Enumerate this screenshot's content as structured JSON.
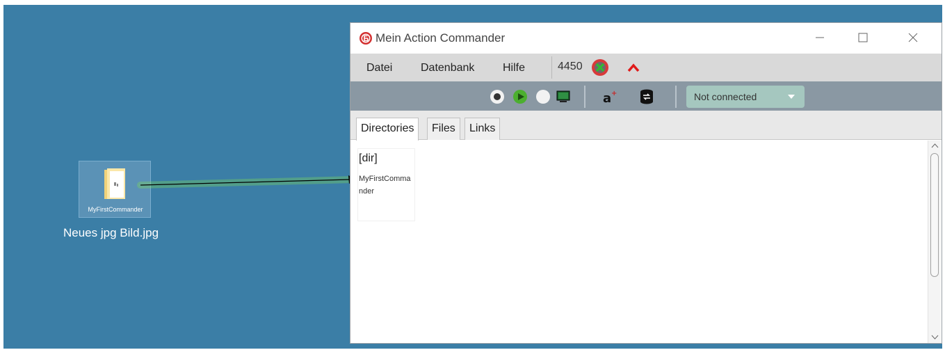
{
  "desktop": {
    "icon_caption": "MyFirstCommander",
    "file_label": "Neues jpg Bild.jpg"
  },
  "window": {
    "title": "Mein Action Commander",
    "controls": {
      "minimize": "minimize-icon",
      "maximize": "maximize-icon",
      "close": "close-icon"
    }
  },
  "menu": {
    "items": [
      "Datei",
      "Datenbank",
      "Hilfe"
    ],
    "port": "4450",
    "status_icon": "disconnected-icon",
    "expand_icon": "caret-up-icon"
  },
  "toolbar": {
    "icons": [
      "record-icon",
      "play-icon",
      "stop-icon",
      "screen-capture-icon",
      "add-text-icon",
      "database-sync-icon"
    ],
    "connection": "Not connected"
  },
  "tabs": [
    "Directories",
    "Files",
    "Links"
  ],
  "active_tab": "Directories",
  "content": {
    "dir_tag": "[dir]",
    "dir_name": "MyFirstCommander"
  },
  "colors": {
    "desktop": "#3b7ea6",
    "menubar": "#d9d9d9",
    "toolbar": "#8a98a3",
    "connection_select": "#a5c7bf",
    "logo_red": "#d32f2f",
    "accent_green": "#2e9d2e"
  }
}
